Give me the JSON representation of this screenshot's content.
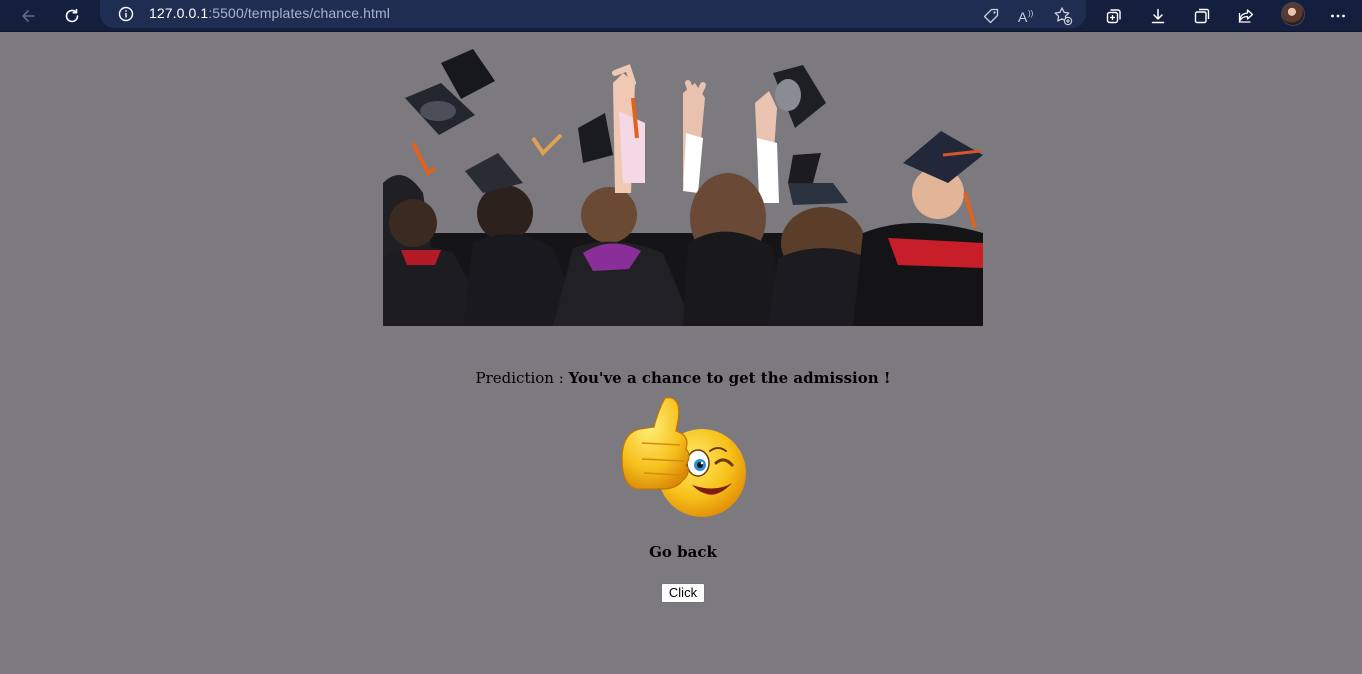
{
  "browser": {
    "url_host": "127.0.0.1",
    "url_path": ":5500/templates/chance.html",
    "icons": [
      "back-icon",
      "refresh-icon",
      "info-icon",
      "tag-icon",
      "read-aloud-icon",
      "favorite-add-icon",
      "collections-icon",
      "download-icon",
      "extensions-icon",
      "share-icon",
      "profile-avatar",
      "more-icon"
    ]
  },
  "page": {
    "background_color": "#7c7a7e",
    "hero_image": "graduation-caps-photo",
    "prediction_label": "Prediction : ",
    "prediction_value": "You've a chance to get the admission !",
    "emoji": "thumbs-up-wink-emoji",
    "go_back_heading": "Go back",
    "click_button": "Click"
  }
}
